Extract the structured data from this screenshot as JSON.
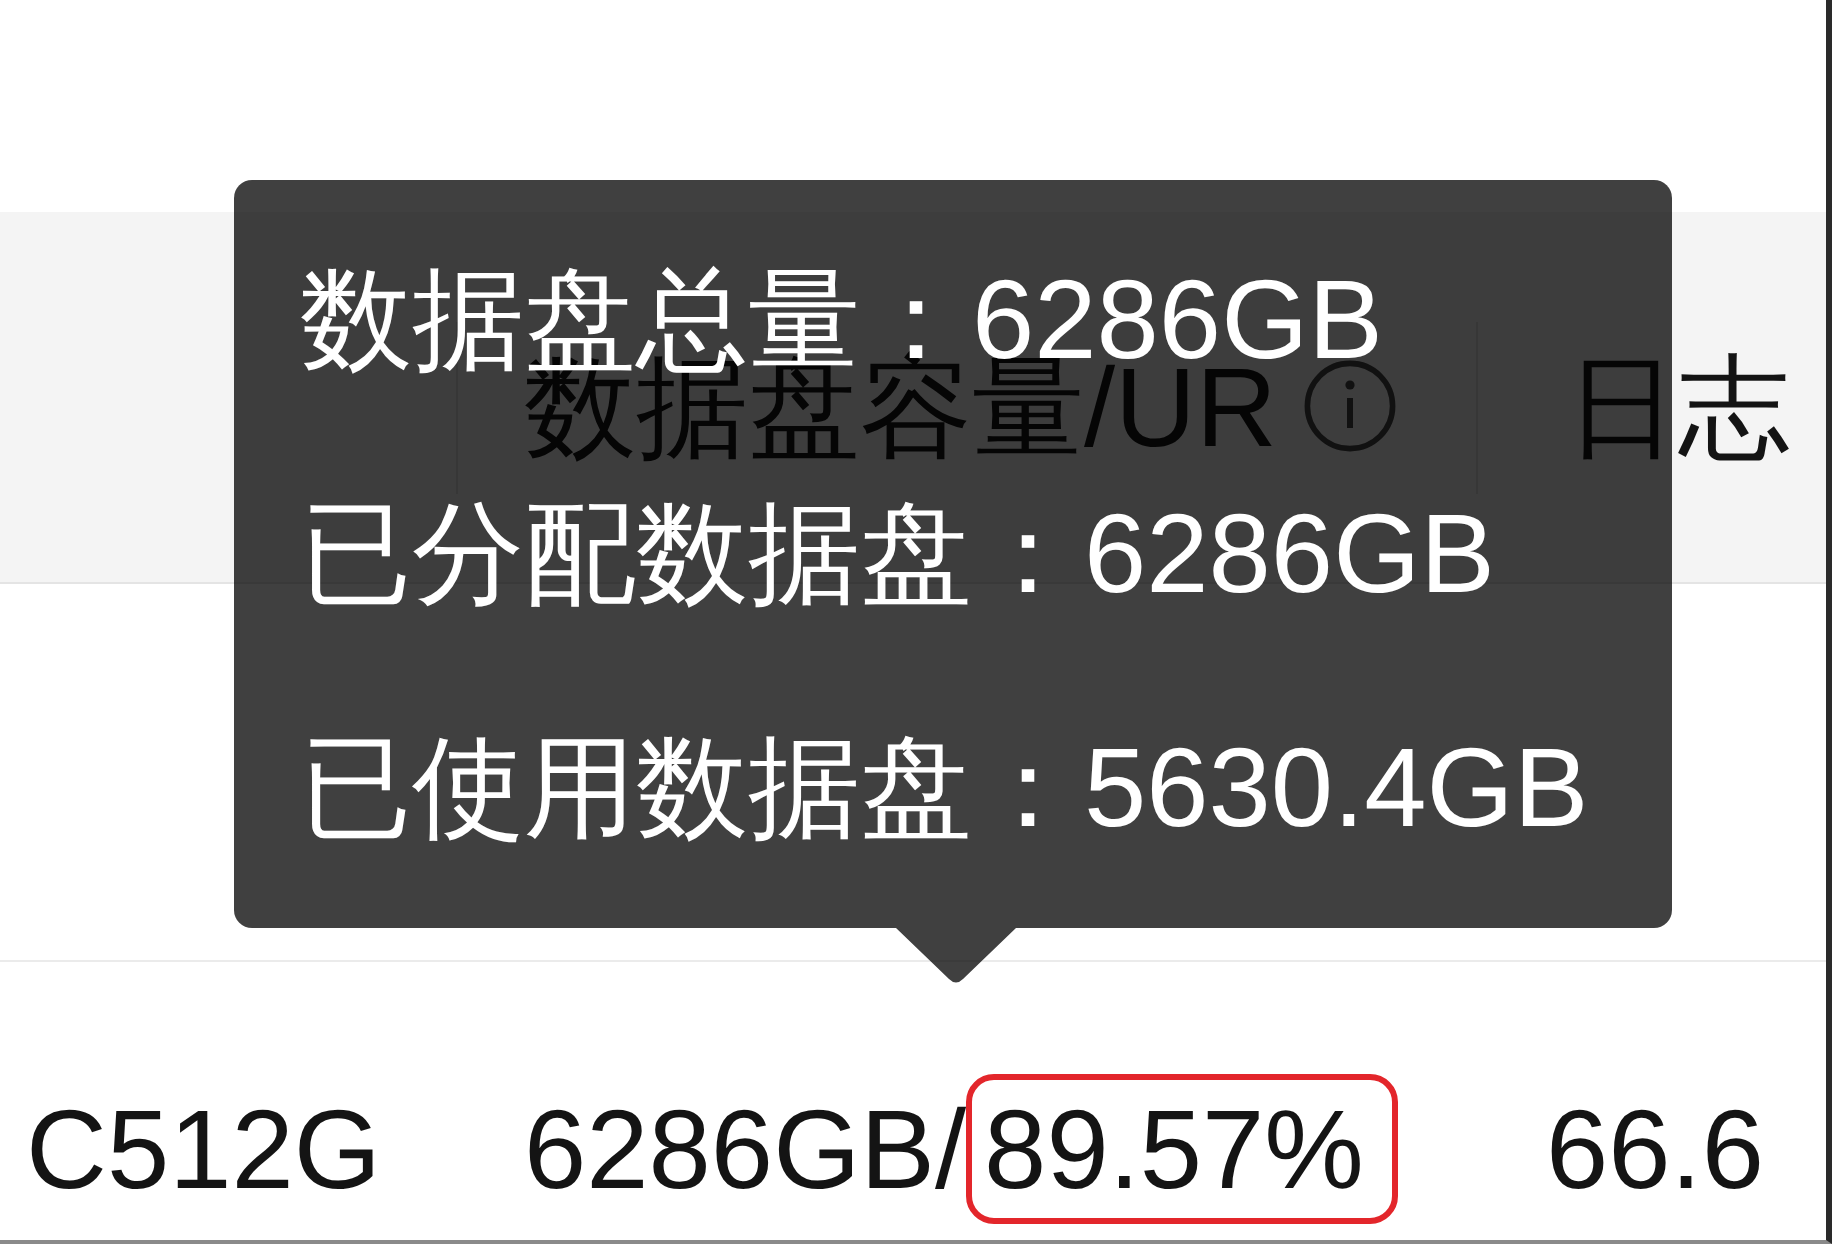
{
  "header": {
    "columns": [
      {
        "label": "数据盘容量/UR",
        "info_icon": true
      },
      {
        "label": "日志"
      }
    ]
  },
  "rows": [
    {
      "cells": [
        {
          "kind": "text",
          "text": "C512G"
        },
        {
          "kind": "usage",
          "total": "6286GB/",
          "percent": "89.57%",
          "highlighted": true
        },
        {
          "kind": "text",
          "text": "66.6"
        }
      ]
    }
  ],
  "tooltip": {
    "lines": [
      "数据盘总量：6286GB",
      "已分配数据盘：6286GB",
      "已使用数据盘：5630.4GB"
    ]
  }
}
